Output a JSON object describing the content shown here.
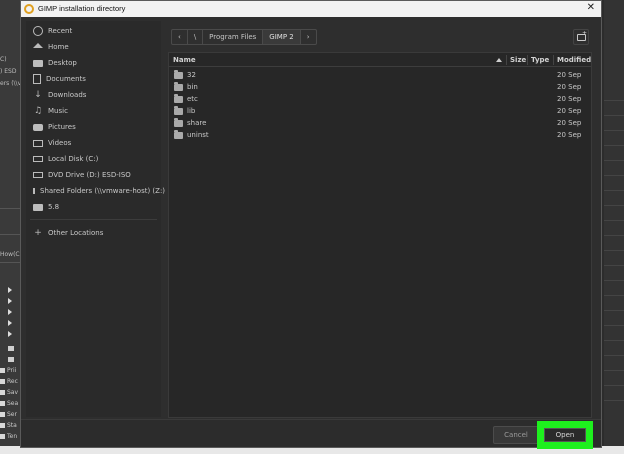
{
  "background": {
    "left_fragments": [
      "C)",
      ") ESD",
      "ers (\\\\vi",
      "How(C"
    ],
    "left_list": [
      "Prii",
      "Rec",
      "Sav",
      "Sea",
      "Ser",
      "Sta",
      "Ten"
    ]
  },
  "dialog": {
    "title": "GIMP installation directory",
    "close_glyph": "✕"
  },
  "sidebar": {
    "items": [
      {
        "label": "Recent",
        "icon": "clock-icon"
      },
      {
        "label": "Home",
        "icon": "home-icon"
      },
      {
        "label": "Desktop",
        "icon": "folder-icon"
      },
      {
        "label": "Documents",
        "icon": "document-icon"
      },
      {
        "label": "Downloads",
        "icon": "download-icon"
      },
      {
        "label": "Music",
        "icon": "music-icon"
      },
      {
        "label": "Pictures",
        "icon": "camera-icon"
      },
      {
        "label": "Videos",
        "icon": "video-icon"
      },
      {
        "label": "Local Disk (C:)",
        "icon": "drive-icon"
      },
      {
        "label": "DVD Drive (D:) ESD-ISO",
        "icon": "drive-icon"
      },
      {
        "label": "Shared Folders (\\\\vmware-host) (Z:)",
        "icon": "drive-icon"
      },
      {
        "label": "5.8",
        "icon": "folder-icon"
      }
    ],
    "other_locations": "Other Locations",
    "plus_glyph": "+"
  },
  "pathbar": {
    "back_glyph": "‹",
    "root_glyph": "\\",
    "segments": [
      "Program Files",
      "GIMP 2"
    ],
    "forward_glyph": "›"
  },
  "filelist": {
    "columns": {
      "name": "Name",
      "size": "Size",
      "type": "Type",
      "modified": "Modified"
    },
    "rows": [
      {
        "name": "32",
        "modified": "20 Sep"
      },
      {
        "name": "bin",
        "modified": "20 Sep"
      },
      {
        "name": "etc",
        "modified": "20 Sep"
      },
      {
        "name": "lib",
        "modified": "20 Sep"
      },
      {
        "name": "share",
        "modified": "20 Sep"
      },
      {
        "name": "uninst",
        "modified": "20 Sep"
      }
    ]
  },
  "footer": {
    "cancel_label": "Cancel",
    "open_label": "Open",
    "highlight_color": "#1ef01e"
  }
}
